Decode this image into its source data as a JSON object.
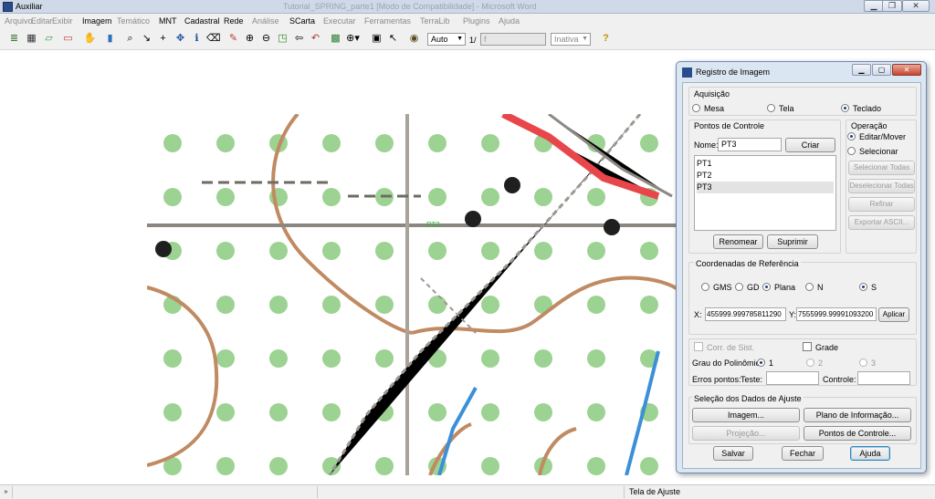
{
  "window": {
    "title": "Auxiliar",
    "doc_title": "Tutorial_SPRING_parte1 [Modo de Compatibilidade] - Microsoft Word"
  },
  "menu": [
    {
      "label": "Arquivo",
      "enabled": false
    },
    {
      "label": "Editar",
      "enabled": false
    },
    {
      "label": "Exibir",
      "enabled": false
    },
    {
      "label": "Imagem",
      "enabled": true
    },
    {
      "label": "Temático",
      "enabled": false
    },
    {
      "label": "MNT",
      "enabled": true
    },
    {
      "label": "Cadastral",
      "enabled": true
    },
    {
      "label": "Rede",
      "enabled": true
    },
    {
      "label": "Análise",
      "enabled": false
    },
    {
      "label": "SCarta",
      "enabled": true
    },
    {
      "label": "Executar",
      "enabled": false
    },
    {
      "label": "Ferramentas",
      "enabled": false
    },
    {
      "label": "TerraLib",
      "enabled": false
    },
    {
      "label": "Plugins",
      "enabled": false
    },
    {
      "label": "Ajuda",
      "enabled": false
    }
  ],
  "toolbar": {
    "zoom_mode": "Auto",
    "page_indicator": "1/",
    "page_field": "f",
    "state_select": "Inativa"
  },
  "map": {
    "cursor_label": "PT3"
  },
  "dialog": {
    "title": "Registro de Imagem",
    "aquisicao": {
      "legend": "Aquisição",
      "options": [
        "Mesa",
        "Tela",
        "Teclado"
      ],
      "selected": "Teclado"
    },
    "pontos": {
      "legend": "Pontos de Controle",
      "nome_label": "Nome:",
      "nome_value": "PT3",
      "criar": "Criar",
      "items": [
        "PT1",
        "PT2",
        "PT3"
      ],
      "selected": "PT3",
      "renomear": "Renomear",
      "suprimir": "Suprimir"
    },
    "operacao": {
      "legend": "Operação",
      "options": [
        "Editar/Mover",
        "Selecionar"
      ],
      "selected": "Editar/Mover",
      "buttons": [
        "Selecionar Todas",
        "Deselecionar Todas",
        "Refinar",
        "Exportar ASCII..."
      ]
    },
    "coordenadas": {
      "legend": "Coordenadas de Referência",
      "options": [
        "GMS",
        "GD",
        "Plana"
      ],
      "selected": "Plana",
      "hemi": [
        "N",
        "S"
      ],
      "hemi_selected": "S",
      "x_label": "X:",
      "x_value": "455999.999785811290",
      "y_label": "Y:",
      "y_value": "7555999.99991093200",
      "aplicar": "Aplicar"
    },
    "opcoes": {
      "corr": "Corr. de Sist.",
      "grade": "Grade",
      "grau_label": "Grau do Polinômio:",
      "grau_options": [
        "1",
        "2",
        "3"
      ],
      "grau_selected": "1",
      "erros_label": "Erros pontos:",
      "teste_label": "Teste:",
      "controle_label": "Controle:"
    },
    "selecao": {
      "legend": "Seleção dos Dados de Ajuste",
      "imagem": "Imagem...",
      "plano": "Plano de Informação...",
      "projecao": "Projeção...",
      "pontos": "Pontos de Controle..."
    },
    "footer": {
      "salvar": "Salvar",
      "fechar": "Fechar",
      "ajuda": "Ajuda"
    }
  },
  "status": {
    "mode": "Tela de Ajuste"
  }
}
